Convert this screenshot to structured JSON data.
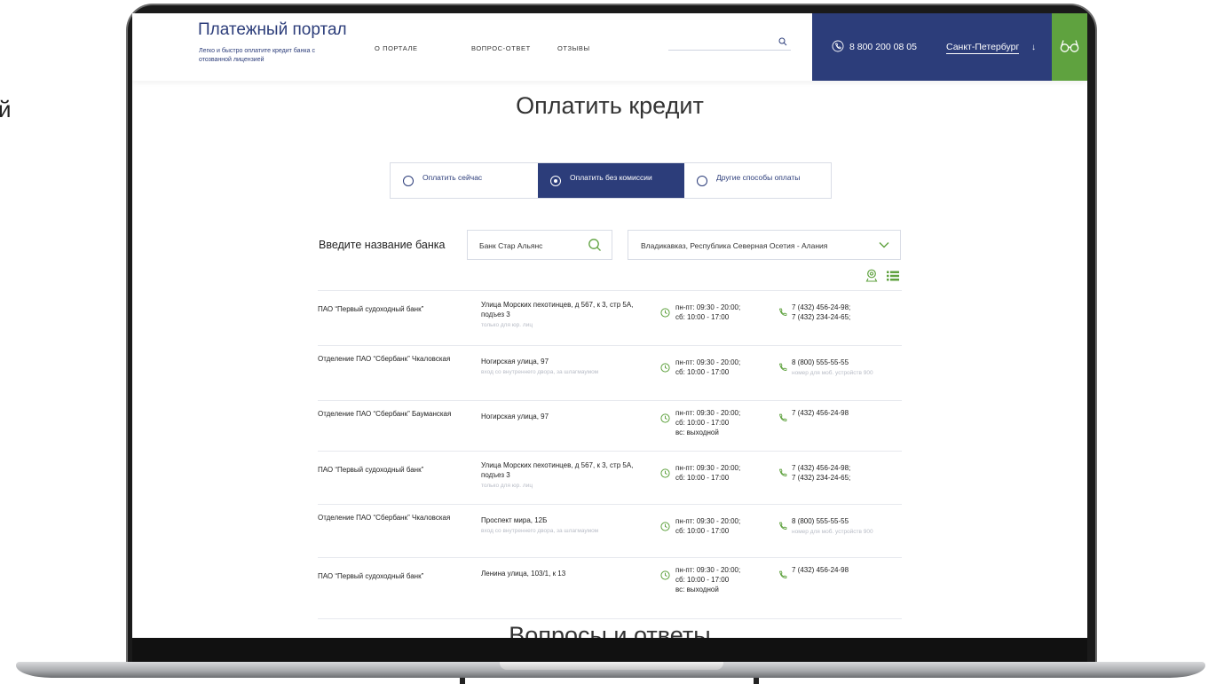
{
  "stray_char": "й",
  "header": {
    "logo_title": "Платежный портал",
    "logo_subtitle": "Легко и быстро оплатите кредит банка с отозванной лицензией",
    "nav": [
      "О ПОРТАЛЕ",
      "ВОПРОС-ОТВЕТ",
      "ОТЗЫВЫ"
    ],
    "search_value": "",
    "phone": "8 800 200 08 05",
    "city": "Санкт-Петербург",
    "city_arrow": "↓"
  },
  "page_title": "Оплатить кредит",
  "tabs": [
    {
      "label": "Оплатить сейчас",
      "active": false
    },
    {
      "label": "Оплатить без комиссии",
      "active": true
    },
    {
      "label": "Другие способы оплаты",
      "active": false
    }
  ],
  "filter": {
    "bank_label": "Введите название банка",
    "bank_value": "Банк Стар Альянс",
    "city_value": "Владикавказ, Республика Северная Осетия - Алания"
  },
  "branches": [
    {
      "name": "ПАО “Первый судоходный банк”",
      "address": "Улица Морских пехотинцев, д 567, к 3, стр 5А, подъез 3",
      "note": "только для юр. лиц",
      "hours": [
        "пн-пт: 09:30 - 20:00;",
        "сб: 10:00 - 17:00"
      ],
      "phones": [
        "7 (432) 456-24-98;",
        "7 (432) 234-24-65;"
      ],
      "phone_note": ""
    },
    {
      "name": "Отделение ПАО “Сбербанк” Чкаловская",
      "address": "Ногирская улица, 97",
      "note": "вход со внутреннего двора, за шлагмаумом",
      "hours": [
        "пн-пт: 09:30 - 20:00;",
        "сб: 10:00 - 17:00"
      ],
      "phones": [
        "8 (800) 555-55-55"
      ],
      "phone_note": "номер для моб. устройств 900"
    },
    {
      "name": "Отделение ПАО “Сбербанк” Бауманская",
      "address": "Ногирская улица, 97",
      "note": "",
      "hours": [
        "пн-пт: 09:30 - 20:00;",
        "сб: 10:00 - 17:00",
        "вс: выходной"
      ],
      "phones": [
        "7 (432) 456-24-98"
      ],
      "phone_note": ""
    },
    {
      "name": "ПАО “Первый судоходный банк”",
      "address": "Улица Морских пехотинцев, д 567, к 3, стр 5А, подъез 3",
      "note": "только для юр. лиц",
      "hours": [
        "пн-пт: 09:30 - 20:00;",
        "сб: 10:00 - 17:00"
      ],
      "phones": [
        "7 (432) 456-24-98;",
        "7 (432) 234-24-65;"
      ],
      "phone_note": ""
    },
    {
      "name": "Отделение ПАО “Сбербанк” Чкаловская",
      "address": "Проспект мира, 12Б",
      "note": "вход со внутреннего двора, за шлагмаумом",
      "hours": [
        "пн-пт: 09:30 - 20:00;",
        "сб: 10:00 - 17:00"
      ],
      "phones": [
        "8 (800) 555-55-55"
      ],
      "phone_note": "номер для моб. устройств 900"
    },
    {
      "name": "ПАО “Первый судоходный банк”",
      "address": "Ленина улица, 103/1, к 13",
      "note": "",
      "hours": [
        "пн-пт: 09:30 - 20:00;",
        "сб: 10:00 - 17:00",
        "вс: выходной"
      ],
      "phones": [
        "7 (432) 456-24-98"
      ],
      "phone_note": ""
    }
  ],
  "next_section_title": "Вопросы и ответы",
  "colors": {
    "brand_blue": "#2c3d7a",
    "brand_green": "#5fa23f"
  }
}
